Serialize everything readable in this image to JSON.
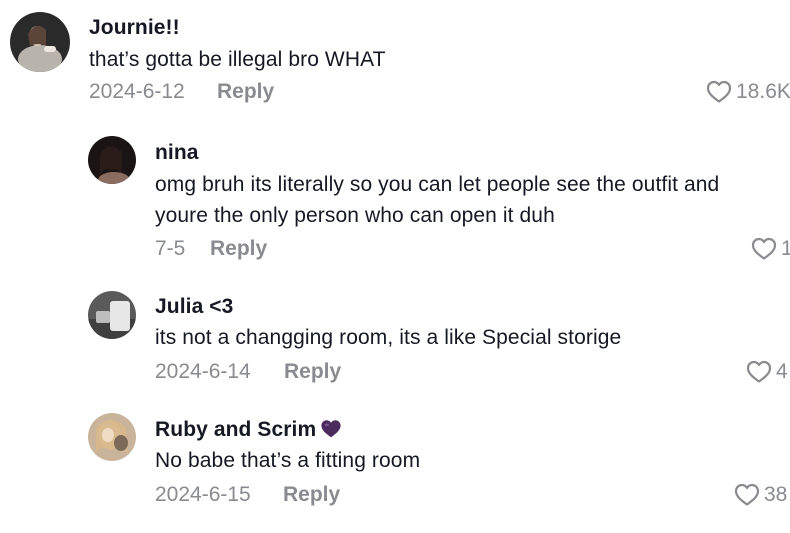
{
  "comments": [
    {
      "username": "Journie!!",
      "text": "that’s gotta be illegal bro WHAT",
      "date": "2024-6-12",
      "reply_label": "Reply",
      "likes": "18.6K",
      "avatar_colors": {
        "bg": "#2b2a2a",
        "fg": "#d8d3cc"
      }
    },
    {
      "username": "nina",
      "text": "omg bruh its literally so you can let people see the outfit and youre the only person who can open it duh",
      "date": "7-5",
      "reply_label": "Reply",
      "likes": "1",
      "avatar_colors": {
        "bg": "#1a1514",
        "fg": "#c9a89a"
      }
    },
    {
      "username": "Julia <3",
      "text": "its not a changging room, its a like Special storige",
      "date": "2024-6-14",
      "reply_label": "Reply",
      "likes": "4",
      "avatar_colors": {
        "bg": "#5a5a5a",
        "fg": "#e7e7e7"
      }
    },
    {
      "username": "Ruby and Scrim",
      "username_emoji": "purple-heart",
      "text": "No babe that’s a fitting room",
      "date": "2024-6-15",
      "reply_label": "Reply",
      "likes": "38",
      "avatar_colors": {
        "bg": "#c9b49b",
        "fg": "#7b6a58"
      }
    }
  ],
  "colors": {
    "text": "#161823",
    "muted": "#8a8b91",
    "emoji_heart": "#4b2a5e"
  }
}
